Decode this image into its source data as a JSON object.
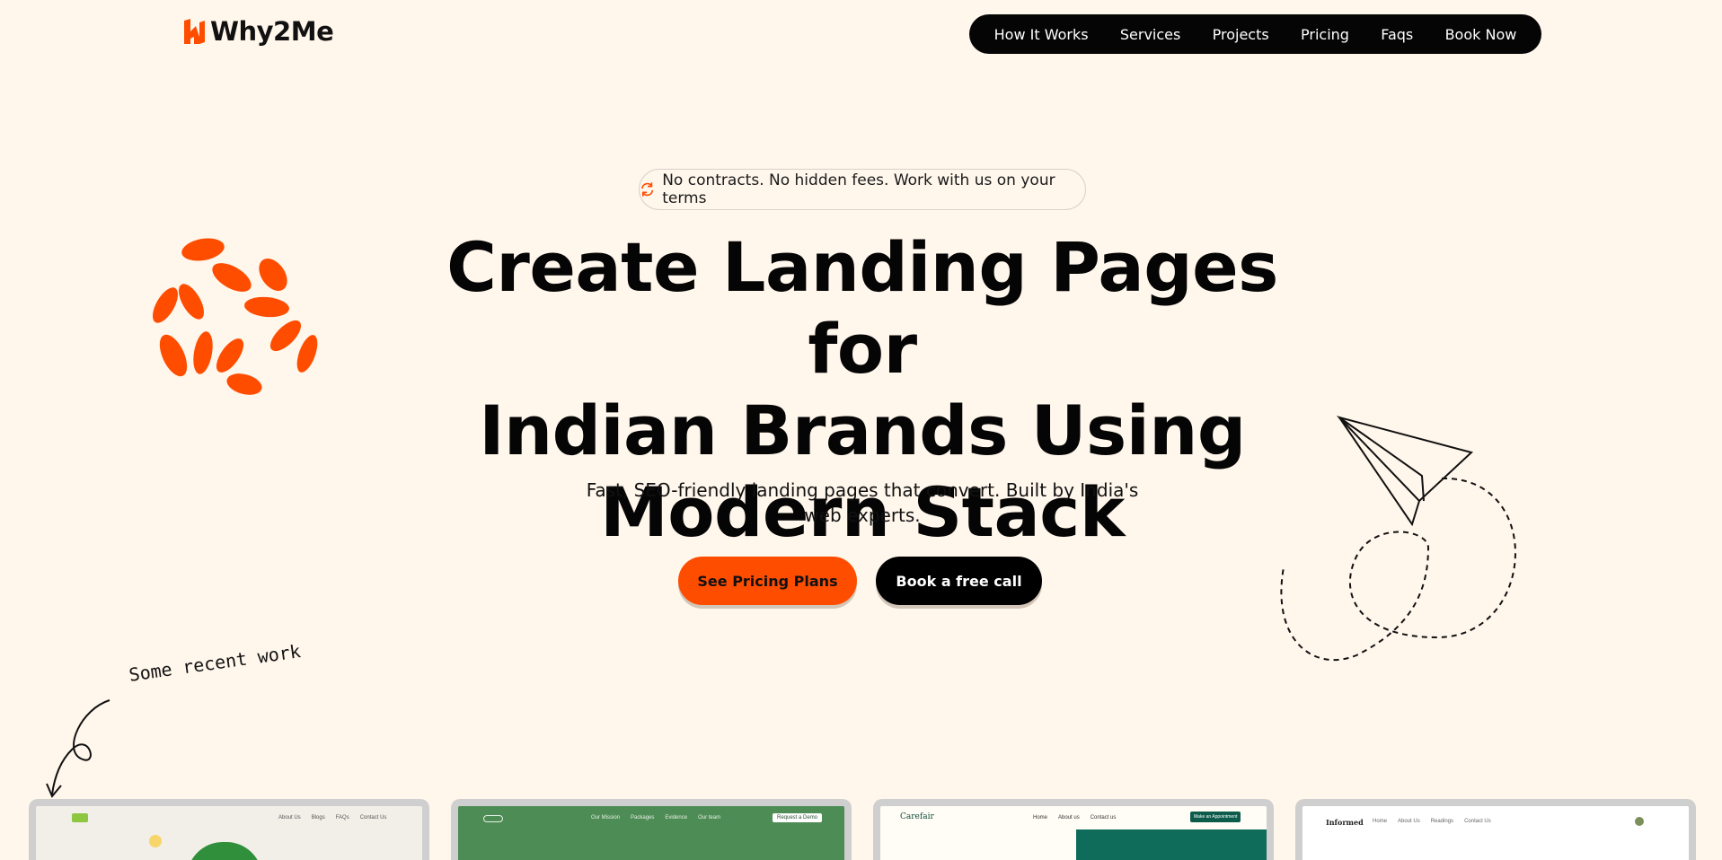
{
  "header": {
    "logo_text": "Why2Me",
    "nav": [
      "How It Works",
      "Services",
      "Projects",
      "Pricing",
      "Faqs",
      "Book Now"
    ]
  },
  "hero": {
    "pill_text": "No contracts. No hidden fees. Work with us on your terms",
    "title_lines": [
      "Create Landing Pages for",
      "Indian Brands Using",
      "Modern Stack"
    ],
    "subtitle": "Fast, SEO-friendly landing pages that convert. Built by India's web experts.",
    "primary_button": "See Pricing Plans",
    "secondary_button": "Book a free call"
  },
  "recent_work": {
    "label": "Some recent work",
    "cards": [
      {
        "name": "loop-grain",
        "nav": [
          "About Us",
          "Blogs",
          "FAQs",
          "Contact Us"
        ]
      },
      {
        "name": "green-site",
        "nav": [
          "Our Mission",
          "Packages",
          "Evidence",
          "Our team"
        ],
        "cta": "Request a Demo"
      },
      {
        "name": "carefair",
        "brand": "Carefair",
        "nav": [
          "Home",
          "About us",
          "Contact us"
        ],
        "cta": "Make an Appointment"
      },
      {
        "name": "informed",
        "brand": "Informed",
        "nav": [
          "Home",
          "About Us",
          "Readings",
          "Contact Us"
        ]
      }
    ]
  },
  "colors": {
    "background": "#fff6ec",
    "accent": "#ff4d00",
    "dark": "#050505"
  }
}
